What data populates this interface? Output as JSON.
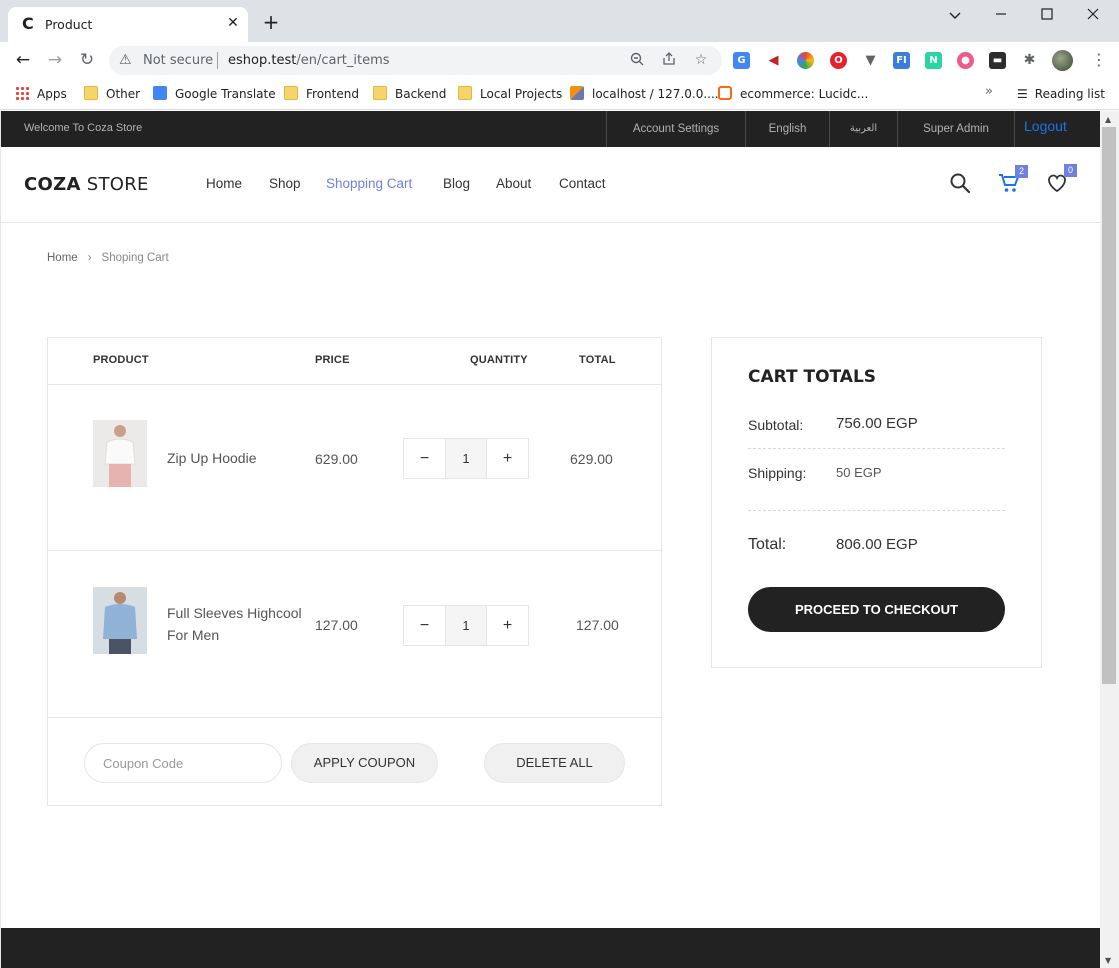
{
  "browser": {
    "tab_title": "Product",
    "tab_favicon": "C",
    "security_label": "Not secure",
    "url_host": "eshop.test",
    "url_path": "/en/cart_items",
    "bookmarks": [
      {
        "label": "Apps"
      },
      {
        "label": "Other"
      },
      {
        "label": "Google Translate"
      },
      {
        "label": "Frontend"
      },
      {
        "label": "Backend"
      },
      {
        "label": "Local Projects"
      },
      {
        "label": "localhost / 127.0.0...."
      },
      {
        "label": "ecommerce: Lucidc..."
      }
    ],
    "reading_list": "Reading list"
  },
  "topbar": {
    "welcome": "Welcome To Coza Store",
    "links": [
      "Account Settings",
      "English",
      "العربية",
      "Super Admin"
    ],
    "logout": "Logout"
  },
  "header": {
    "logo_bold": "COZA",
    "logo_rest": " STORE",
    "nav": [
      "Home",
      "Shop",
      "Shopping Cart",
      "Blog",
      "About",
      "Contact"
    ],
    "active_nav": "Shopping Cart",
    "cart_count": "2",
    "wishlist_count": "0",
    "accent_color": "#717fe0"
  },
  "breadcrumb": {
    "home": "Home",
    "separator": "›",
    "current": "Shoping Cart"
  },
  "cart": {
    "columns": [
      "PRODUCT",
      "PRICE",
      "QUANTITY",
      "TOTAL"
    ],
    "items": [
      {
        "name": "Zip Up Hoodie",
        "price": "629.00",
        "qty": "1",
        "total": "629.00"
      },
      {
        "name": "Full Sleeves Highcool For Men",
        "price": "127.00",
        "qty": "1",
        "total": "127.00"
      }
    ],
    "coupon_placeholder": "Coupon Code",
    "apply_label": "APPLY COUPON",
    "delete_label": "DELETE ALL"
  },
  "totals": {
    "title": "CART TOTALS",
    "subtotal_label": "Subtotal:",
    "subtotal_value": "756.00 EGP",
    "shipping_label": "Shipping:",
    "shipping_value": "50 EGP",
    "total_label": "Total:",
    "total_value": "806.00 EGP",
    "checkout_label": "PROCEED TO CHECKOUT"
  }
}
